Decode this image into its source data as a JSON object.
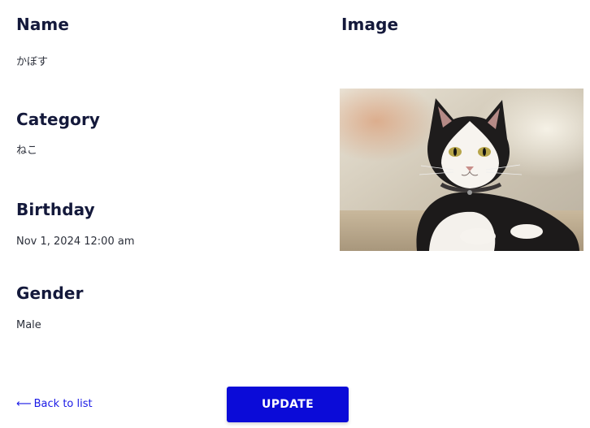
{
  "fields": {
    "name": {
      "label": "Name",
      "value": "かぼす"
    },
    "category": {
      "label": "Category",
      "value": "ねこ"
    },
    "birthday": {
      "label": "Birthday",
      "value": "Nov 1, 2024 12:00 am"
    },
    "gender": {
      "label": "Gender",
      "value": "Male"
    }
  },
  "image": {
    "label": "Image",
    "subject": "cat-photo"
  },
  "actions": {
    "back_label": "Back to list",
    "back_icon": "arrow-left-icon",
    "update_label": "UPDATE"
  },
  "colors": {
    "heading": "#14193b",
    "link": "#1a1ae6",
    "button": "#0b0bd8"
  }
}
